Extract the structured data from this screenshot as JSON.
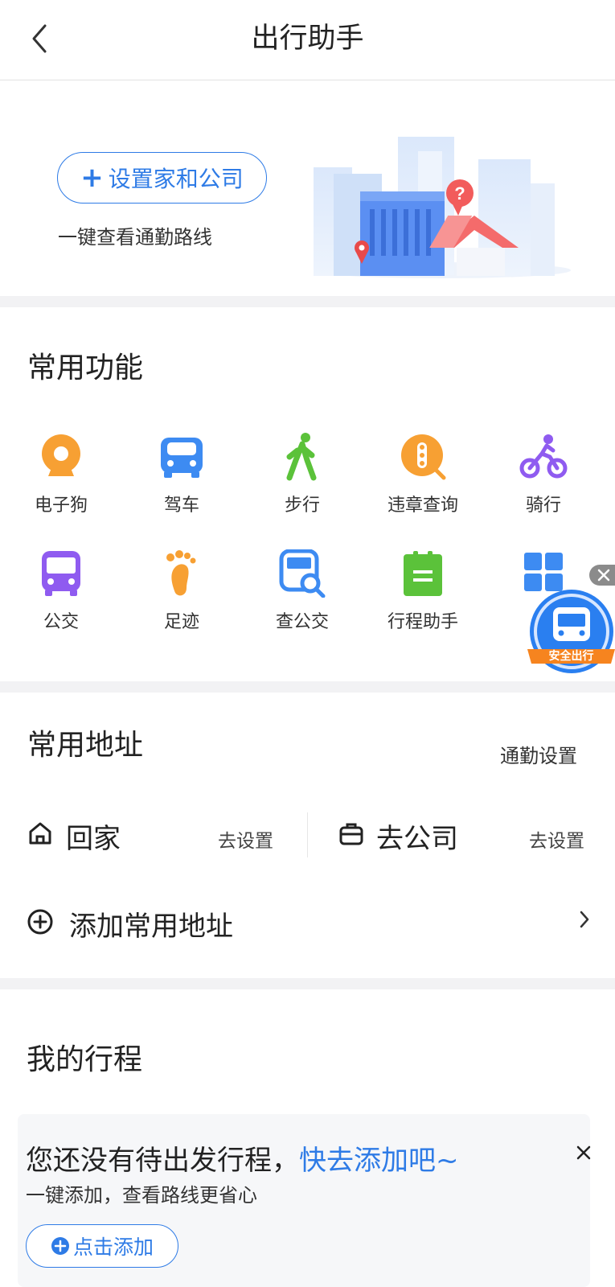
{
  "header": {
    "title": "出行助手",
    "back_icon": "chevron-left-icon"
  },
  "hero": {
    "set_button": "设置家和公司",
    "subtitle": "一键查看通勤路线"
  },
  "functions": {
    "title": "常用功能",
    "items": [
      {
        "label": "电子狗",
        "icon": "radar-camera-icon",
        "color": "#f7a033"
      },
      {
        "label": "驾车",
        "icon": "car-icon",
        "color": "#3d8bf2"
      },
      {
        "label": "步行",
        "icon": "walk-icon",
        "color": "#5bc23a"
      },
      {
        "label": "违章查询",
        "icon": "traffic-light-icon",
        "color": "#f7a033"
      },
      {
        "label": "骑行",
        "icon": "bicycle-icon",
        "color": "#8f5bf0"
      },
      {
        "label": "公交",
        "icon": "bus-icon",
        "color": "#8f5bf0"
      },
      {
        "label": "足迹",
        "icon": "footprint-icon",
        "color": "#f7a033"
      },
      {
        "label": "查公交",
        "icon": "bus-search-icon",
        "color": "#3d8bf2"
      },
      {
        "label": "行程助手",
        "icon": "itinerary-icon",
        "color": "#5bc23a"
      },
      {
        "label": "",
        "icon": "more-grid-icon",
        "color": "#3d8bf2"
      }
    ]
  },
  "floating": {
    "badge_text": "安全出行"
  },
  "addresses": {
    "title": "常用地址",
    "commute_setting": "通勤设置",
    "home": {
      "label": "回家",
      "action": "去设置"
    },
    "work": {
      "label": "去公司",
      "action": "去设置"
    },
    "add_label": "添加常用地址"
  },
  "trips": {
    "title": "我的行程",
    "empty_message": "您还没有待出发行程，",
    "empty_link": "快去添加吧~",
    "subtitle": "一键添加，查看路线更省心",
    "add_button": "点击添加"
  }
}
